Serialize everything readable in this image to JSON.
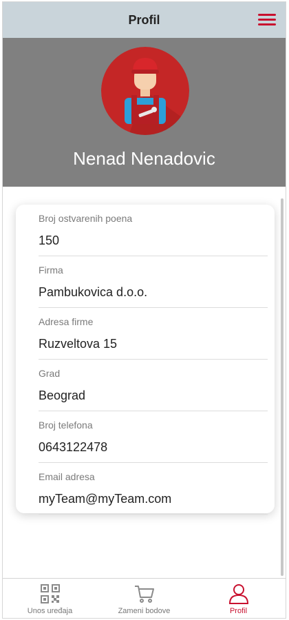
{
  "header": {
    "title": "Profil",
    "menu_icon": "hamburger-menu-icon"
  },
  "profile": {
    "name": "Nenad Nenadovic",
    "avatar_icon": "mechanic-avatar-icon",
    "fields": [
      {
        "label": "Broj ostvarenih poena",
        "value": "150"
      },
      {
        "label": "Firma",
        "value": "Pambukovica d.o.o."
      },
      {
        "label": "Adresa firme",
        "value": "Ruzveltova 15"
      },
      {
        "label": "Grad",
        "value": "Beograd"
      },
      {
        "label": "Broj telefona",
        "value": "0643122478"
      },
      {
        "label": "Email adresa",
        "value": "myTeam@myTeam.com"
      }
    ]
  },
  "bottom_nav": {
    "items": [
      {
        "label": "Unos uređaja",
        "icon": "qr-code-icon"
      },
      {
        "label": "Zameni bodove",
        "icon": "cart-icon"
      },
      {
        "label": "Profil",
        "icon": "user-icon",
        "active": true
      }
    ]
  },
  "colors": {
    "accent": "#c8102e",
    "header_bg": "#c9d4da",
    "hero_bg": "#808080",
    "avatar_bg": "#c42626"
  }
}
